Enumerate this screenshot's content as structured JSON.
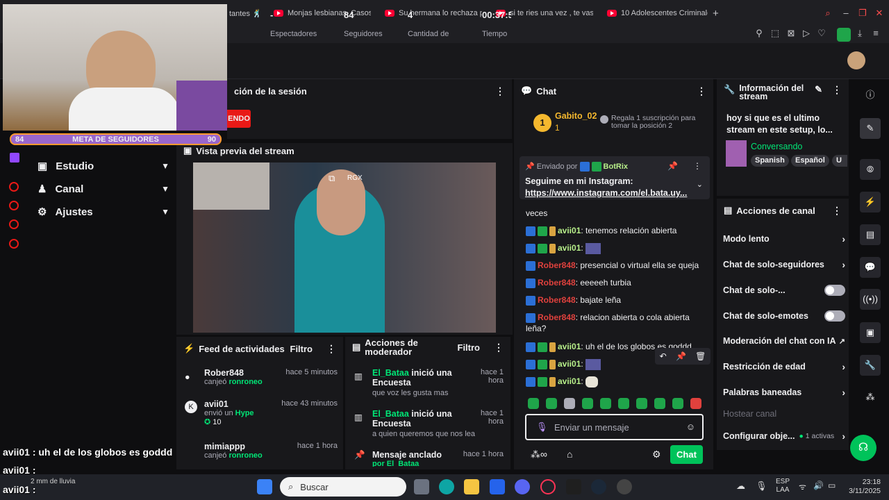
{
  "browser_tabs": [
    {
      "title": "tantes 🕺"
    },
    {
      "title": "Monjas lesbianas, Casos"
    },
    {
      "title": "Su hermana lo rechaza p"
    },
    {
      "title": "si te ries una vez , te vas"
    },
    {
      "title": "10 Adolescentes Criminale"
    }
  ],
  "new_tab_label": "+",
  "webcam_goal": {
    "label": "META DE SEGUIDORES",
    "current": "84",
    "target": "90"
  },
  "session": {
    "title": "ción de la sesión",
    "live_badge": "ENDO"
  },
  "stats": [
    {
      "value": "-",
      "label": "Espectadores"
    },
    {
      "value": "84",
      "label": "Seguidores"
    },
    {
      "value": "4",
      "label": "Cantidad de"
    },
    {
      "value": "00:37:5",
      "label": "Tiempo"
    }
  ],
  "left_nav": [
    {
      "label": "Estudio"
    },
    {
      "label": "Canal"
    },
    {
      "label": "Ajustes"
    }
  ],
  "preview": {
    "title": "Vista previa del stream",
    "badge": "RGX"
  },
  "chat": {
    "title": "Chat",
    "top_user": "Gabito_02",
    "top_count": "1",
    "rank_badge": "1",
    "gift_text": "Regala 1 suscripción para tomar la posición 2",
    "pinned_by": "Enviado por",
    "pinned_user": "BotRix",
    "pinned_text": "Seguime en mi Instagram:",
    "pinned_link": "https://www.instagram.com/el.bata.uy...",
    "partial_line": "veces",
    "messages": [
      {
        "user": "avii01",
        "text": ": tenemos relación abierta",
        "color": "green"
      },
      {
        "user": "avii01",
        "text": ":",
        "color": "green"
      },
      {
        "user": "Rober848",
        "text": ": presencial o virtual ella se queja",
        "color": "red"
      },
      {
        "user": "Rober848",
        "text": ": eeeeeh turbia",
        "color": "red"
      },
      {
        "user": "Rober848",
        "text": ": bajate leña",
        "color": "red"
      },
      {
        "user": "Rober848",
        "text": ": relacion abierta o cola abierta leña?",
        "color": "red"
      },
      {
        "user": "avii01",
        "text": ": uh el de los globos es goddd",
        "color": "green"
      },
      {
        "user": "avii01",
        "text": ":",
        "color": "green"
      },
      {
        "user": "avii01",
        "text": ":",
        "color": "green"
      }
    ],
    "input_placeholder": "Enviar un mensaje",
    "send_label": "Chat"
  },
  "stream_info": {
    "title": "Información del stream",
    "stream_title": "hoy si que es el ultimo stream en este setup, lo...",
    "category": "Conversando",
    "tags": [
      "Spanish",
      "Español",
      "U"
    ]
  },
  "channel_actions": {
    "title": "Acciones de canal",
    "items": [
      {
        "label": "Modo lento",
        "control": "arrow"
      },
      {
        "label": "Chat de solo-seguidores",
        "control": "arrow"
      },
      {
        "label": "Chat de solo-...",
        "control": "toggle"
      },
      {
        "label": "Chat de solo-emotes",
        "control": "toggle"
      },
      {
        "label": "Moderación del chat con IA",
        "control": "external"
      },
      {
        "label": "Restricción de edad",
        "control": "arrow"
      },
      {
        "label": "Palabras baneadas",
        "control": "arrow"
      },
      {
        "label": "Hostear canal",
        "control": "none"
      },
      {
        "label": "Configurar obje...",
        "control": "arrow",
        "extra": "1 activas"
      }
    ]
  },
  "activity_feed": {
    "title": "Feed de actividades",
    "filter": "Filtro",
    "items": [
      {
        "user": "Rober848",
        "time": "hace 5 minutos",
        "action": "canjeó",
        "reward": "ronroneo"
      },
      {
        "user": "avii01",
        "time": "hace 43 minutos",
        "action": "envió un",
        "reward": "Hype",
        "amount": "10"
      },
      {
        "user": "mimiappp",
        "time": "hace 1 hora",
        "action": "canjeó",
        "reward": "ronroneo"
      }
    ]
  },
  "mod_actions": {
    "title": "Acciones de moderador",
    "filter": "Filtro",
    "items": [
      {
        "user": "El_Bataa",
        "action": "inició una Encuesta",
        "time": "hace 1 hora",
        "detail": "que voz les gusta mas"
      },
      {
        "user": "El_Bataa",
        "action": "inició una Encuesta",
        "time": "hace 1 hora",
        "detail": "a quien queremos que nos lea"
      },
      {
        "user": "",
        "action": "Mensaje anclado",
        "time": "hace 1 hora",
        "detail": "por El_Bataa"
      }
    ]
  },
  "overlay_chat": [
    {
      "text": "avii01 : uh el de los globos es goddd"
    },
    {
      "text": "avii01 :"
    },
    {
      "text": "avii01 :"
    }
  ],
  "weather": "2 mm de lluvia",
  "taskbar": {
    "search_placeholder": "Buscar",
    "lang": "ESP",
    "lang2": "LAA",
    "time": "23:18",
    "date": "3/11/2025"
  },
  "colors": {
    "accent": "#9147ff",
    "live": "#e91916",
    "green": "#00e676"
  }
}
